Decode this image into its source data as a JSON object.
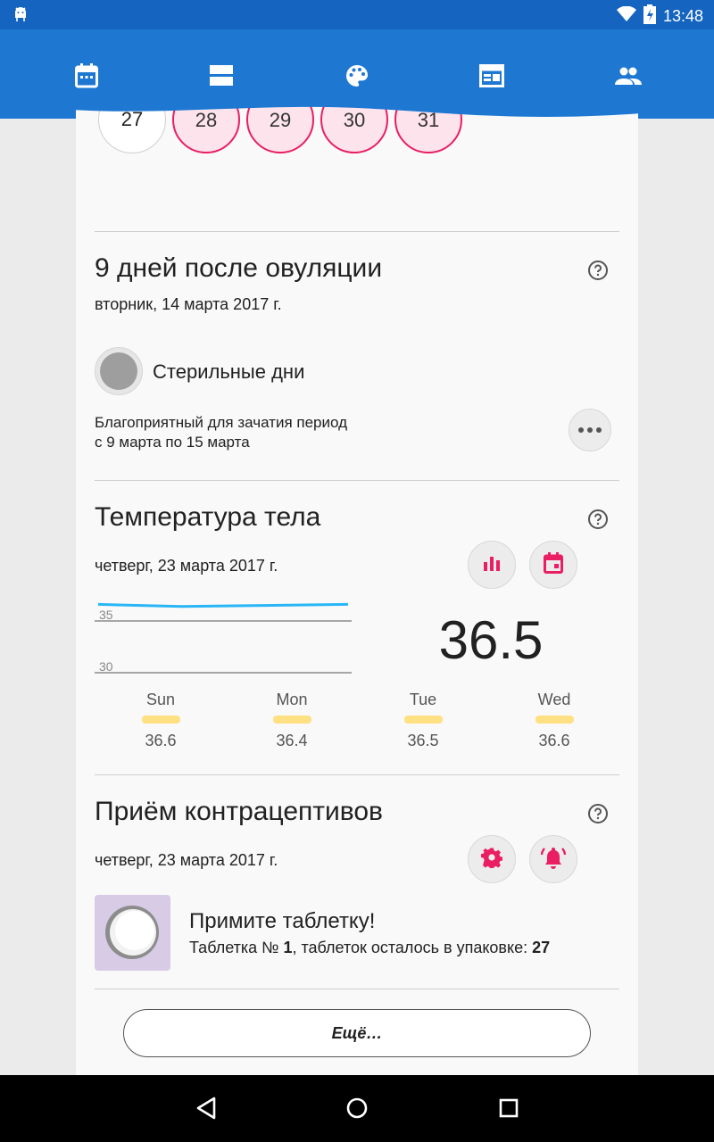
{
  "status_bar": {
    "time": "13:48",
    "icons": [
      "android-debug-icon",
      "wifi-icon",
      "battery-icon"
    ]
  },
  "app_bar": {
    "tabs": [
      {
        "name": "calendar-icon"
      },
      {
        "name": "list-view-icon"
      },
      {
        "name": "palette-icon"
      },
      {
        "name": "schedule-icon"
      },
      {
        "name": "people-icon"
      }
    ]
  },
  "calendar_row": [
    "27",
    "28",
    "29",
    "30",
    "31"
  ],
  "ovulation": {
    "title": "9 дней после овуляции",
    "date": "вторник, 14 марта 2017 г.",
    "status_label": "Стерильные дни",
    "fertile_line1": "Благоприятный для зачатия период",
    "fertile_line2": "с 9 марта по 15 марта"
  },
  "temperature": {
    "title": "Температура тела",
    "date": "четверг, 23 марта 2017 г.",
    "current": "36.5",
    "days": [
      {
        "name": "Sun",
        "value": "36.6"
      },
      {
        "name": "Mon",
        "value": "36.4"
      },
      {
        "name": "Tue",
        "value": "36.5"
      },
      {
        "name": "Wed",
        "value": "36.6"
      }
    ],
    "chart_ticks": [
      "35",
      "30"
    ],
    "line_color": "#29b6f6"
  },
  "chart_data": {
    "type": "line",
    "x": [
      "Sun",
      "Mon",
      "Tue",
      "Wed"
    ],
    "series": [
      {
        "values": [
          36.6,
          36.4,
          36.5,
          36.6
        ]
      }
    ],
    "ylim": [
      30,
      37
    ],
    "yticks": [
      35,
      30
    ]
  },
  "contraceptives": {
    "title": "Приём контрацептивов",
    "date": "четверг, 23 марта 2017 г.",
    "take_pill": "Примите таблетку!",
    "pill_info_prefix": "Таблетка № ",
    "pill_number": "1",
    "pill_info_middle": ", таблеток осталось в упаковке: ",
    "pills_left": "27"
  },
  "more_button": "Ещё…",
  "colors": {
    "accent": "#e91e63",
    "primary": "#1e78d2",
    "status": "#1565c0"
  }
}
